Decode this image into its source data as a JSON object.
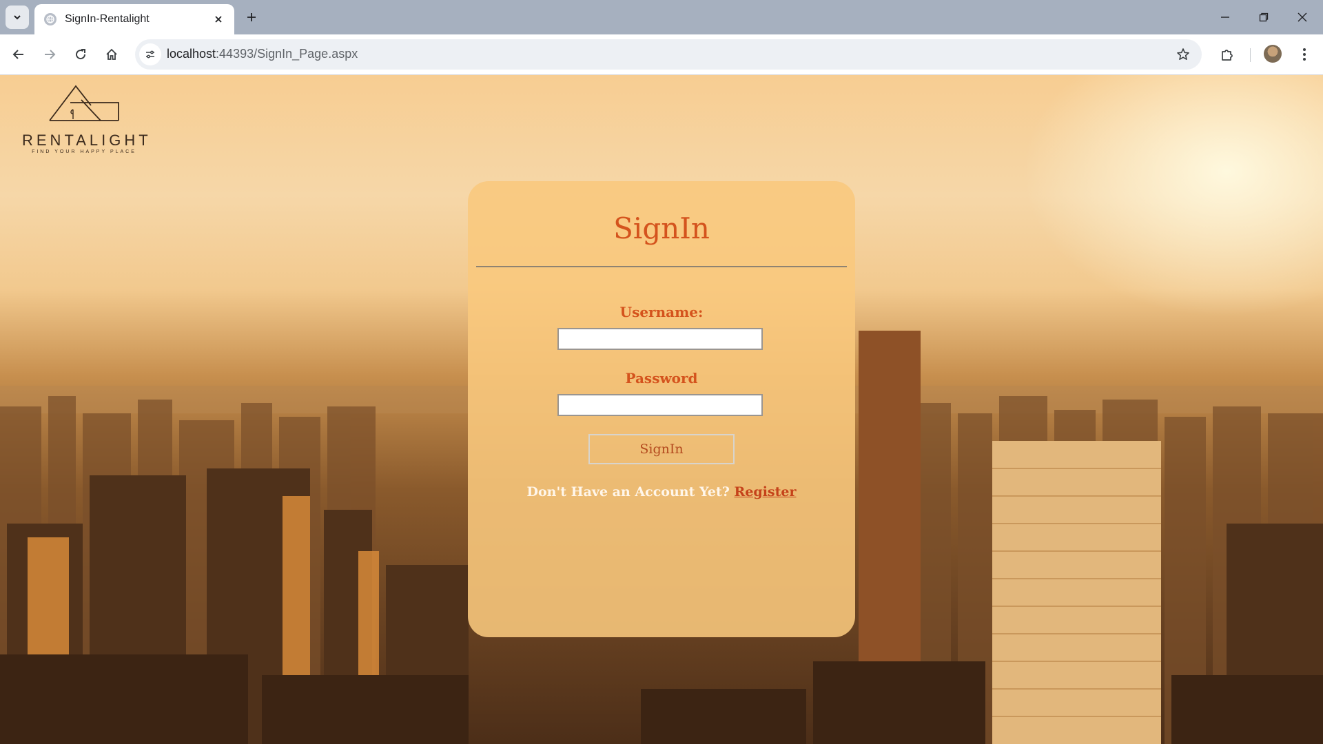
{
  "browser": {
    "tab": {
      "title": "SignIn-Rentalight"
    },
    "omnibox": {
      "host": "localhost",
      "path": ":44393/SignIn_Page.aspx"
    }
  },
  "icons": {
    "tab_list": "chevron-down-icon",
    "favicon": "globe-icon",
    "tab_close": "close-icon",
    "new_tab": "plus-icon",
    "back": "arrow-left-icon",
    "forward": "arrow-right-icon",
    "reload": "reload-icon",
    "home": "home-icon",
    "site_info": "tune-icon",
    "bookmark": "star-icon",
    "extensions": "puzzle-icon",
    "menu": "kebab-icon"
  },
  "page": {
    "logo": {
      "brand": "RENTALIGHT",
      "tagline": "FIND YOUR HAPPY PLACE"
    },
    "signin": {
      "title": "SignIn",
      "username_label": "Username:",
      "username_value": "",
      "password_label": "Password",
      "password_value": "",
      "submit_label": "SignIn",
      "prompt": "Don't Have an Account Yet?",
      "register_label": "Register"
    }
  },
  "colors": {
    "accent": "#d4531d",
    "card": "#f9c87d",
    "tabstrip": "#a6b0bf"
  }
}
